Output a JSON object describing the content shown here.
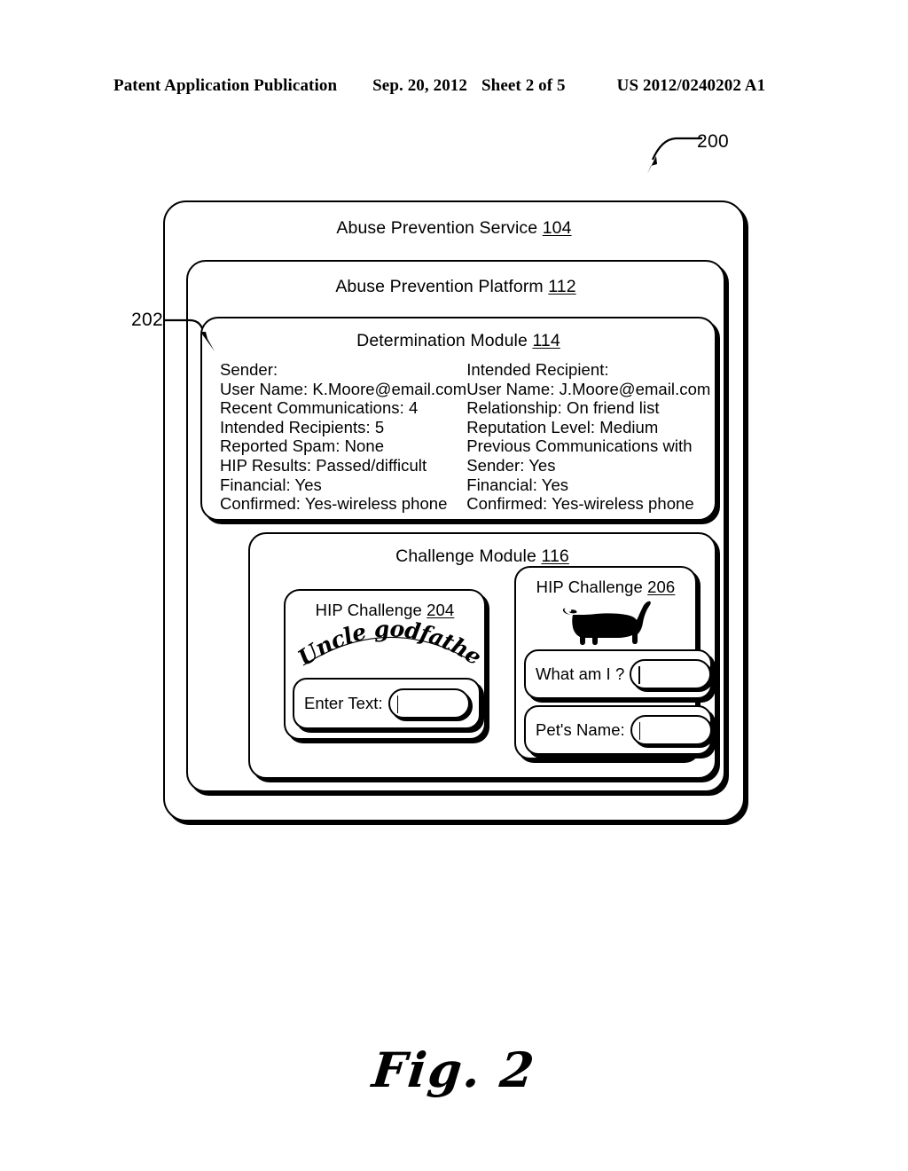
{
  "header": {
    "publication": "Patent Application Publication",
    "date": "Sep. 20, 2012",
    "sheet": "Sheet 2 of 5",
    "document_number": "US 2012/0240202 A1"
  },
  "callouts": {
    "figure_ref": "200",
    "determination_ref": "202"
  },
  "boxes": {
    "service": {
      "title": "Abuse Prevention Service ",
      "ref": "104"
    },
    "platform": {
      "title": "Abuse Prevention Platform ",
      "ref": "112"
    },
    "determination": {
      "title": "Determination Module ",
      "ref": "114"
    },
    "challenge": {
      "title": "Challenge Module ",
      "ref": "116"
    },
    "hip_204": {
      "title": "HIP Challenge ",
      "ref": "204"
    },
    "hip_206": {
      "title": "HIP Challenge ",
      "ref": "206"
    }
  },
  "determination": {
    "sender": {
      "lines": [
        "Sender:",
        "User Name:  K.Moore@email.com",
        "Recent Communications:  4",
        "Intended Recipients: 5",
        "Reported Spam: None",
        "HIP Results: Passed/difficult",
        "Financial: Yes",
        "Confirmed: Yes-wireless phone"
      ]
    },
    "recipient": {
      "lines": [
        "Intended Recipient:",
        "User Name: J.Moore@email.com",
        "Relationship:  On friend list",
        "Reputation Level: Medium",
        "Previous Communications with",
        "Sender: Yes",
        "Financial: Yes",
        "Confirmed: Yes-wireless phone"
      ]
    }
  },
  "hip_204": {
    "captcha_text": "Uncle godfather",
    "field_label": "Enter Text:",
    "field_value": ""
  },
  "hip_206": {
    "image_subject": "dog-silhouette",
    "fields": [
      {
        "label": "What am I ?",
        "value": ""
      },
      {
        "label": "Pet's Name:",
        "value": ""
      }
    ]
  },
  "figure_caption": "Fig. 2",
  "colors": {
    "ink": "#000000",
    "paper": "#ffffff"
  }
}
